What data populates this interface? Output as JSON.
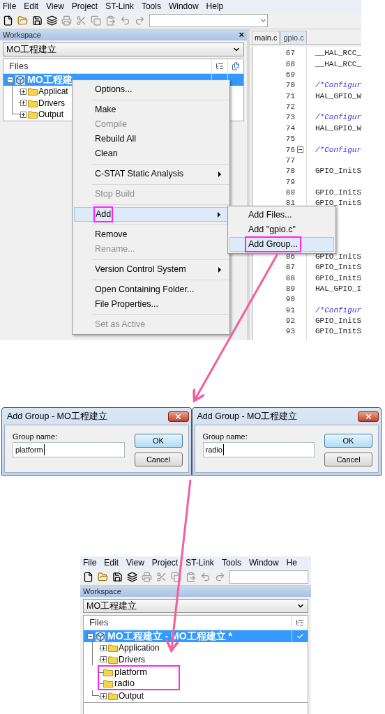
{
  "main_window": {
    "menu": [
      "File",
      "Edit",
      "View",
      "Project",
      "ST-Link",
      "Tools",
      "Window",
      "Help"
    ],
    "workspace": {
      "title": "Workspace",
      "close": "×",
      "project_select": "MO工程建立",
      "files_header": "Files",
      "tree": {
        "label": "MO工程建",
        "selected": true,
        "children": [
          {
            "label": "Applicat",
            "expandable": true
          },
          {
            "label": "Drivers",
            "expandable": true
          },
          {
            "label": "Output",
            "expandable": true
          }
        ]
      }
    },
    "editor": {
      "tabs": [
        {
          "label": "main.c",
          "selected": false
        },
        {
          "label": "gpio.c",
          "selected": true
        }
      ],
      "lines": [
        {
          "kind": "code",
          "number": "67",
          "text": "__HAL_RCC_"
        },
        {
          "kind": "code",
          "number": "68",
          "text": "__HAL_RCC_"
        },
        {
          "kind": "code",
          "number": "69"
        },
        {
          "kind": "comment",
          "number": "70",
          "text": "/*Configur"
        },
        {
          "kind": "code",
          "number": "71",
          "text": "HAL_GPIO_W"
        },
        {
          "kind": "code",
          "number": "72"
        },
        {
          "kind": "comment",
          "number": "73",
          "text": "/*Configur"
        },
        {
          "kind": "code",
          "number": "74",
          "text": "HAL_GPIO_W"
        },
        {
          "kind": "code",
          "number": "75"
        },
        {
          "kind": "comment",
          "number": "76",
          "text": "/*Configur",
          "fold": true
        },
        {
          "kind": "code",
          "number": "77"
        },
        {
          "kind": "code",
          "number": "78",
          "text": "GPIO_InitS"
        },
        {
          "kind": "code",
          "number": "79"
        },
        {
          "kind": "code",
          "number": "80",
          "text": "GPIO_InitS"
        },
        {
          "kind": "code",
          "number": "81",
          "text": "GPIO_InitS"
        },
        {
          "kind": "covered"
        },
        {
          "kind": "covered"
        },
        {
          "kind": "covered"
        },
        {
          "kind": "covered"
        },
        {
          "kind": "code",
          "number": "86",
          "text": "GPIO_InitS"
        },
        {
          "kind": "code",
          "number": "87",
          "text": "GPIO_InitS"
        },
        {
          "kind": "code",
          "number": "88",
          "text": "GPIO_InitS"
        },
        {
          "kind": "code",
          "number": "89",
          "text": "HAL_GPIO_I"
        },
        {
          "kind": "code",
          "number": "90"
        },
        {
          "kind": "comment",
          "number": "91",
          "text": "/*Configur"
        },
        {
          "kind": "code",
          "number": "92",
          "text": "GPIO_InitS"
        },
        {
          "kind": "code",
          "number": "93",
          "text": "GPIO_InitS"
        }
      ]
    }
  },
  "context_menu": {
    "items": [
      {
        "kind": "item",
        "label": "Options...",
        "disabled": false,
        "selected": false
      },
      {
        "kind": "separator"
      },
      {
        "kind": "item",
        "label": "Make",
        "disabled": false,
        "selected": false
      },
      {
        "kind": "item",
        "label": "Compile",
        "disabled": true,
        "selected": false
      },
      {
        "kind": "item",
        "label": "Rebuild All",
        "disabled": false,
        "selected": false
      },
      {
        "kind": "item",
        "label": "Clean",
        "disabled": false,
        "selected": false
      },
      {
        "kind": "separator"
      },
      {
        "kind": "item",
        "label": "C-STAT Static Analysis",
        "disabled": false,
        "submenu": true,
        "selected": false
      },
      {
        "kind": "separator"
      },
      {
        "kind": "item",
        "label": "Stop Build",
        "disabled": true,
        "selected": false
      },
      {
        "kind": "separator"
      },
      {
        "kind": "item",
        "label": "Add",
        "disabled": false,
        "submenu": true,
        "selected": true,
        "boxed": true
      },
      {
        "kind": "separator"
      },
      {
        "kind": "item",
        "label": "Remove",
        "disabled": false,
        "selected": false
      },
      {
        "kind": "item",
        "label": "Rename...",
        "disabled": true,
        "selected": false
      },
      {
        "kind": "separator"
      },
      {
        "kind": "item",
        "label": "Version Control System",
        "disabled": false,
        "submenu": true,
        "selected": false
      },
      {
        "kind": "separator"
      },
      {
        "kind": "item",
        "label": "Open Containing Folder...",
        "disabled": false,
        "selected": false
      },
      {
        "kind": "item",
        "label": "File Properties...",
        "disabled": false,
        "selected": false
      },
      {
        "kind": "separator"
      },
      {
        "kind": "item",
        "label": "Set as Active",
        "disabled": true,
        "selected": false
      }
    ]
  },
  "submenu": {
    "items": [
      {
        "label": "Add Files...",
        "selected": false,
        "boxed": false
      },
      {
        "label": "Add \"gpio.c\"",
        "selected": false,
        "boxed": false
      },
      {
        "label": "Add Group...",
        "selected": true,
        "boxed": true
      }
    ]
  },
  "dialogs": [
    {
      "title": "Add Group - MO工程建立",
      "label": "Group name:",
      "value": "platform",
      "ok": "OK",
      "cancel": "Cancel"
    },
    {
      "title": "Add Group - MO工程建立",
      "label": "Group name:",
      "value": "radio",
      "ok": "OK",
      "cancel": "Cancel"
    }
  ],
  "result_window": {
    "menu": [
      "File",
      "Edit",
      "View",
      "Project",
      "ST-Link",
      "Tools",
      "Window",
      "He"
    ],
    "workspace": {
      "title": "Workspace",
      "project_select": "MO工程建立",
      "files_header": "Files",
      "tree": {
        "label": "MO工程建立 - MO工程建立 *",
        "selected": true,
        "checked": true,
        "children": [
          {
            "label": "Application",
            "expandable": true,
            "highlighted": false
          },
          {
            "label": "Drivers",
            "expandable": true,
            "highlighted": false
          },
          {
            "label": "platform",
            "expandable": false,
            "highlighted": true
          },
          {
            "label": "radio",
            "expandable": false,
            "highlighted": true
          },
          {
            "label": "Output",
            "expandable": true,
            "highlighted": false
          }
        ]
      }
    }
  }
}
